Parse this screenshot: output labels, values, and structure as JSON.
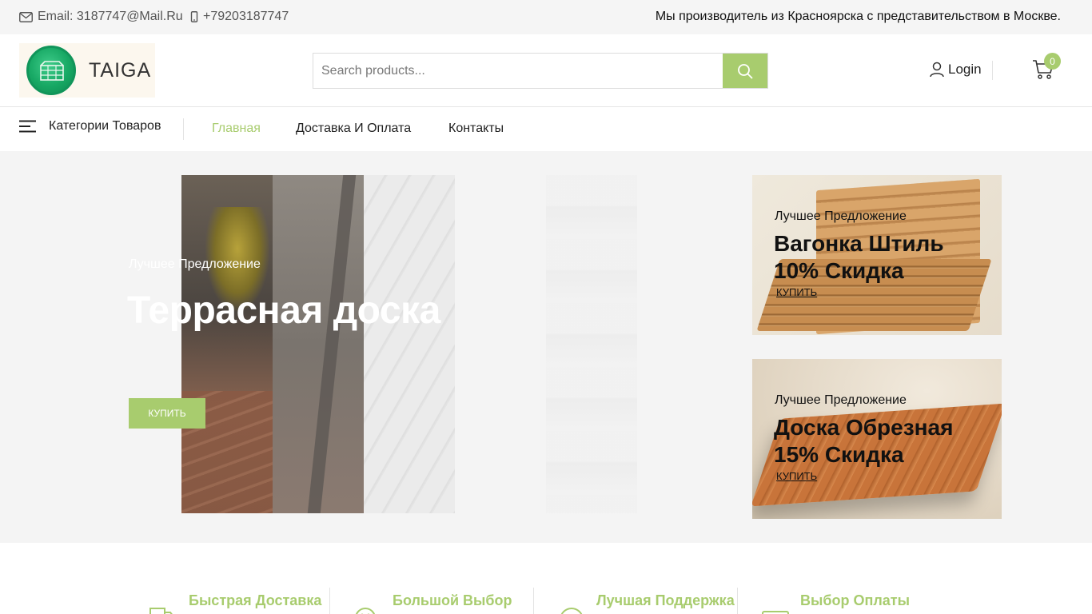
{
  "topbar": {
    "email": "Email: 3187747@Mail.Ru",
    "phone": "+79203187747",
    "tagline": "Мы производитель из Красноярска с представительством в Москве."
  },
  "header": {
    "logo_text": "TAIGA",
    "search_placeholder": "Search products...",
    "login_label": "Login",
    "cart_count": "0"
  },
  "nav": {
    "categories_label": "Категории Товаров",
    "links": [
      "Главная",
      "Доставка И Оплата",
      "Контакты"
    ],
    "active": "Главная"
  },
  "hero": {
    "kicker": "Лучшее Предложение",
    "title": "Террасная доска",
    "button": "КУПИТЬ"
  },
  "banners": [
    {
      "kicker": "Лучшее Предложение",
      "title_line1": "Вагонка Штиль",
      "title_line2": "10% Скидка",
      "button": "КУПИТЬ"
    },
    {
      "kicker": "Лучшее Предложение",
      "title_line1": "Доска Обрезная",
      "title_line2": "15% Скидка",
      "button": "КУПИТЬ"
    }
  ],
  "features": [
    {
      "title": "Быстрая Доставка",
      "icon": "truck-icon"
    },
    {
      "title": "Большой Выбор",
      "icon": "smile-icon"
    },
    {
      "title": "Лучшая Поддержка",
      "icon": "support-icon"
    },
    {
      "title": "Выбор Оплаты",
      "icon": "credit-card-icon"
    }
  ],
  "colors": {
    "accent": "#a8cc6e",
    "topbar_bg": "#f5f5f5",
    "hero_bg": "#f4f4f4"
  }
}
